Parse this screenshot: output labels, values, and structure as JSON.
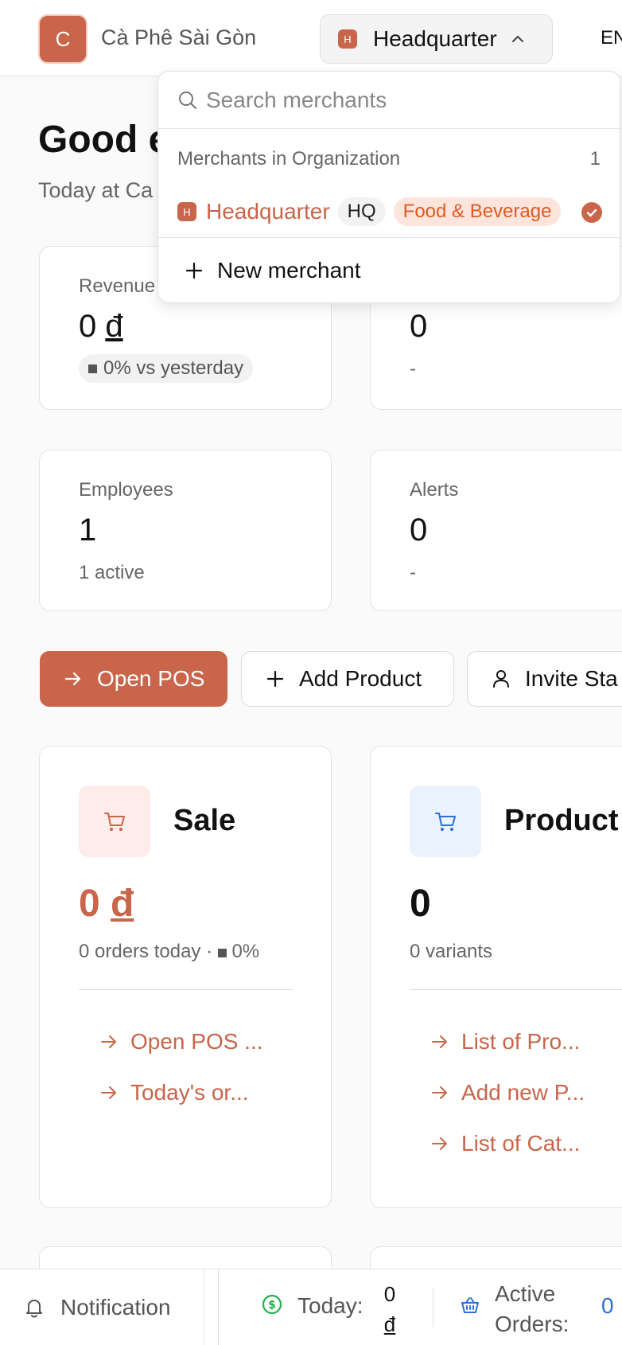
{
  "header": {
    "org_initial": "C",
    "org_name": "Cà Phê Sài Gòn",
    "merchant_badge": "H",
    "merchant_name": "Headquarter",
    "language": "EN"
  },
  "greeting": {
    "title": "Good e",
    "subtitle": "Today at Ca"
  },
  "stats": {
    "revenue": {
      "label": "Revenue",
      "value": "0",
      "currency": "đ",
      "change": "0% vs yesterday"
    },
    "orders": {
      "value": "0",
      "sub": "-"
    },
    "employees": {
      "label": "Employees",
      "value": "1",
      "sub": "1 active"
    },
    "alerts": {
      "label": "Alerts",
      "value": "0",
      "sub": "-"
    }
  },
  "actions": {
    "open_pos": "Open POS",
    "add_product": "Add Product",
    "invite_staff": "Invite Sta"
  },
  "modules": {
    "sale": {
      "title": "Sale",
      "value": "0",
      "currency": "đ",
      "sub_prefix": "0 orders today ·",
      "sub_change": "0%",
      "links": [
        "Open POS ...",
        "Today's or..."
      ]
    },
    "product": {
      "title": "Product",
      "value": "0",
      "sub": "0 variants",
      "links": [
        "List of Pro...",
        "Add new P...",
        "List of Cat..."
      ]
    }
  },
  "bottombar": {
    "notification": "Notification",
    "today_label": "Today:",
    "today_value": "0",
    "today_currency": "đ",
    "orders_label": "Active Orders:",
    "orders_value": "0"
  },
  "dropdown": {
    "search_placeholder": "Search merchants",
    "section_heading": "Merchants in Organization",
    "section_count": "1",
    "item": {
      "badge": "H",
      "name": "Headquarter",
      "tag": "HQ",
      "category": "Food & Beverage"
    },
    "new_merchant": "New merchant"
  },
  "colors": {
    "brand": "#c8654a",
    "category_text": "#e05a1f",
    "category_bg": "#fde4dc",
    "link_blue": "#2d6fd6",
    "success_green": "#22b04b"
  },
  "icons": {
    "merchant_toggle": "chevron-up-icon",
    "search": "search-icon",
    "selected": "check-circle-icon",
    "new": "plus-icon",
    "open_pos": "arrow-right-icon",
    "add_product": "plus-icon",
    "invite_staff": "user-icon",
    "sale": "shopping-cart-icon",
    "product": "shopping-cart-icon",
    "module_link": "arrow-right-icon",
    "notification": "bell-icon",
    "today": "dollar-circle-icon",
    "orders": "basket-icon"
  }
}
